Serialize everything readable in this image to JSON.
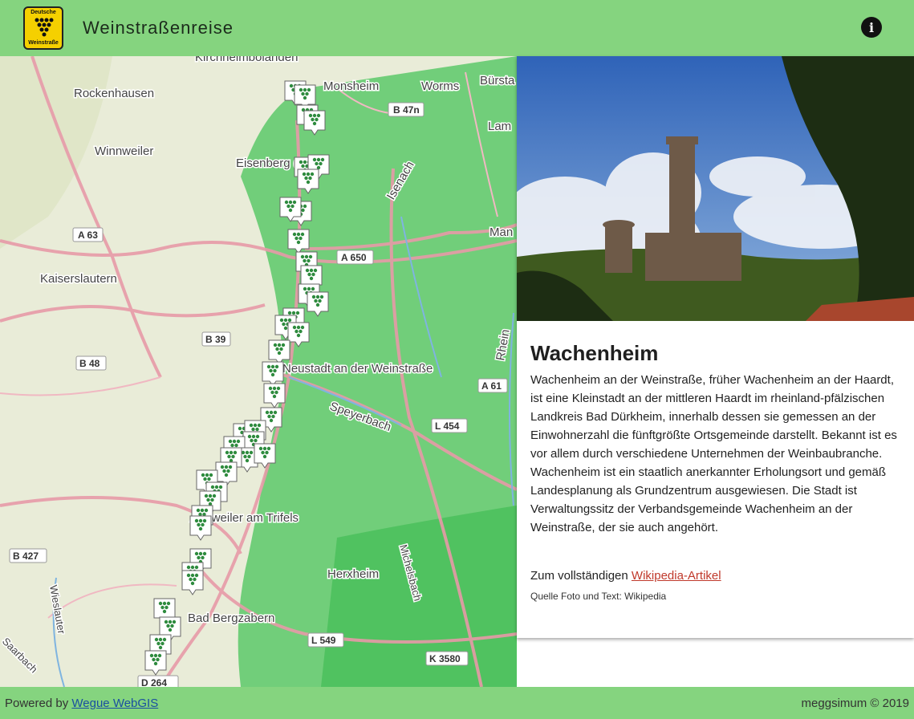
{
  "header": {
    "title": "Weinstraßenreise",
    "logo_text_top": "Deutsche",
    "logo_text_bottom": "Weinstraße",
    "info_icon": "info-icon"
  },
  "map": {
    "labels": {
      "kirchheimbolanden": "Kirchheimbolanden",
      "rockenhausen": "Rockenhausen",
      "monsheim": "Monsheim",
      "worms": "Worms",
      "buerstadt": "Bürsta",
      "b47n": "B 47n",
      "lam": "Lam",
      "winnweiler": "Winnweiler",
      "eisenberg": "Eisenberg (Pfalz)",
      "isenach": "Isenach",
      "a63": "A 63",
      "a650": "A 650",
      "man": "Man",
      "kaiserslautern": "Kaiserslautern",
      "b39": "B 39",
      "b48": "B 48",
      "neustadt": "Neustadt an der Weinstraße",
      "rhein": "Rhein",
      "a61": "A 61",
      "speyerbach": "Speyerbach",
      "l454": "L 454",
      "annweiler": "Annweiler am Trifels",
      "b427": "B 427",
      "herxheim": "Herxheim",
      "michelsbach": "Michelsbach",
      "bad_bergzabern": "Bad Bergzabern",
      "l549": "L 549",
      "k3580": "K 3580",
      "d264": "D 264",
      "wieslauter": "Wieslauter",
      "saarbach": "Saarbach"
    },
    "zoom_in": "+",
    "zoom_out": "−",
    "marker_icon": "grape-marker-icon"
  },
  "info_panel": {
    "title": "Wachenheim",
    "description": "Wachenheim an der Weinstraße, früher Wachenheim an der Haardt, ist eine Kleinstadt an der mittleren Haardt im rheinland-pfälzischen Landkreis Bad Dürkheim, innerhalb dessen sie gemessen an der Einwohnerzahl die fünftgrößte Ortsgemeinde darstellt. Bekannt ist es vor allem durch verschiedene Unternehmen der Weinbaubranche. Wachenheim ist ein staatlich anerkannter Erholungsort und gemäß Landesplanung als Grundzentrum ausgewiesen. Die Stadt ist Verwaltungssitz der Verbandsgemeinde Wachenheim an der Weinstraße, der sie auch angehört.",
    "more_prefix": "Zum vollständigen ",
    "more_link": "Wikipedia-Artikel",
    "source": "Quelle Foto und Text: Wikipedia"
  },
  "footer": {
    "powered_prefix": "Powered by ",
    "powered_link": "Wegue WebGIS",
    "copyright": "meggsimum © 2019"
  },
  "colors": {
    "header_bg": "#85d47f",
    "link": "#c0392b",
    "footer_link": "#1a4fa0",
    "marker_grape": "#2e8b3e"
  }
}
